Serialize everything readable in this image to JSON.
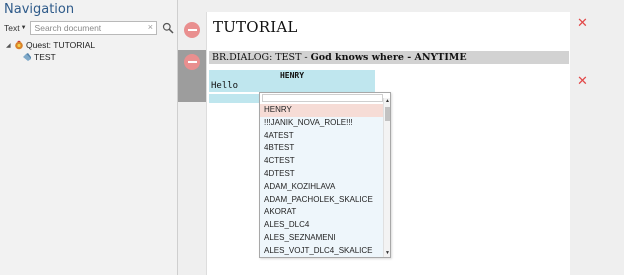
{
  "navigation": {
    "title": "Navigation",
    "search": {
      "mode": "Text",
      "placeholder": "Search document",
      "clear_symbol": "×"
    },
    "tree": [
      {
        "label": "Quest: TUTORIAL",
        "expanded": true,
        "icon": "quest-icon"
      },
      {
        "label": "TEST",
        "icon": "dialog-node-icon"
      }
    ]
  },
  "editor": {
    "title": "TUTORIAL",
    "dialog": {
      "prefix": "BR.DIALOG: TEST - ",
      "bold_text": "God knows where - ANYTIME"
    },
    "speaker": "HENRY",
    "line": "Hello",
    "close_symbol": "✕"
  },
  "dropdown": {
    "selected": "HENRY",
    "options": [
      "HENRY",
      "!!!JANIK_NOVA_ROLE!!!",
      "4ATEST",
      "4BTEST",
      "4CTEST",
      "4DTEST",
      "ADAM_KOZIHLAVA",
      "ADAM_PACHOLEK_SKALICE",
      "AKORAT",
      "ALES_DLC4",
      "ALES_SEZNAMENI",
      "ALES_VOJT_DLC4_SKALICE"
    ]
  },
  "colors": {
    "nav_title": "#2f5b8a",
    "delete_button": "#e98f8f",
    "close_x": "#e24848",
    "dialog_bg": "#bfe6ee",
    "selected_option": "#f6dcd6"
  }
}
